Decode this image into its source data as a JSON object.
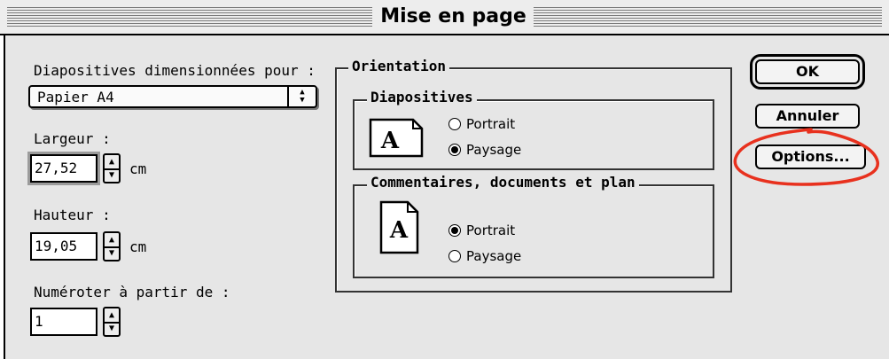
{
  "window": {
    "title": "Mise en page"
  },
  "slides": {
    "sized_for_label": "Diapositives dimensionnées pour  :",
    "paper_size": "Papier A4",
    "width_label": "Largeur  :",
    "width_value": "27,52",
    "width_unit": "cm",
    "height_label": "Hauteur  :",
    "height_value": "19,05",
    "height_unit": "cm",
    "number_from_label": "Numéroter à partir de  :",
    "number_from_value": "1"
  },
  "orientation": {
    "title": "Orientation",
    "slides_group": {
      "title": "Diapositives",
      "options": [
        {
          "label": "Portrait",
          "selected": false
        },
        {
          "label": "Paysage",
          "selected": true
        }
      ]
    },
    "notes_group": {
      "title": "Commentaires, documents et plan",
      "options": [
        {
          "label": "Portrait",
          "selected": true
        },
        {
          "label": "Paysage",
          "selected": false
        }
      ]
    },
    "icon_glyph": "A"
  },
  "buttons": {
    "ok": "OK",
    "cancel": "Annuler",
    "options": "Options..."
  },
  "annotation": {
    "color": "#e8311e"
  }
}
